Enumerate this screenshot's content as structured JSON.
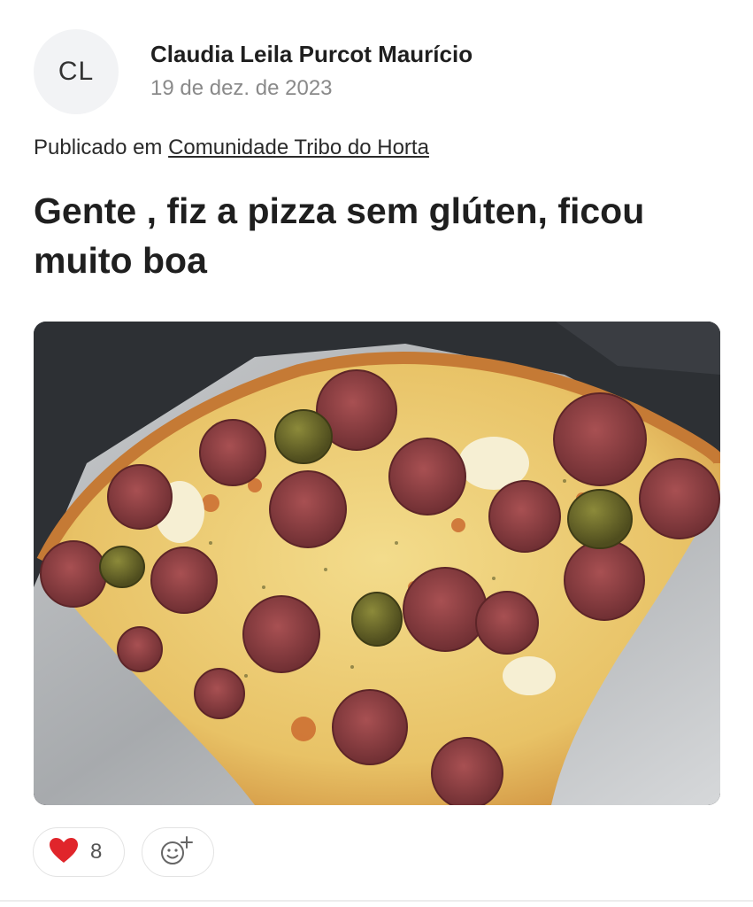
{
  "author": {
    "initials": "CL",
    "name": "Claudia Leila Purcot Maurício",
    "date": "19 de dez. de 2023"
  },
  "community": {
    "prefix": "Publicado em",
    "name": "Comunidade Tribo do Horta"
  },
  "post": {
    "title": "Gente , fiz a pizza sem glúten, ficou muito boa",
    "image_alt": "pizza"
  },
  "reactions": {
    "heart_count": "8",
    "heart_icon": "heart-icon",
    "add_icon": "add-reaction-icon"
  },
  "colors": {
    "heart": "#e0252b",
    "border": "#e3e3e3",
    "muted_text": "#8a8a8a"
  }
}
